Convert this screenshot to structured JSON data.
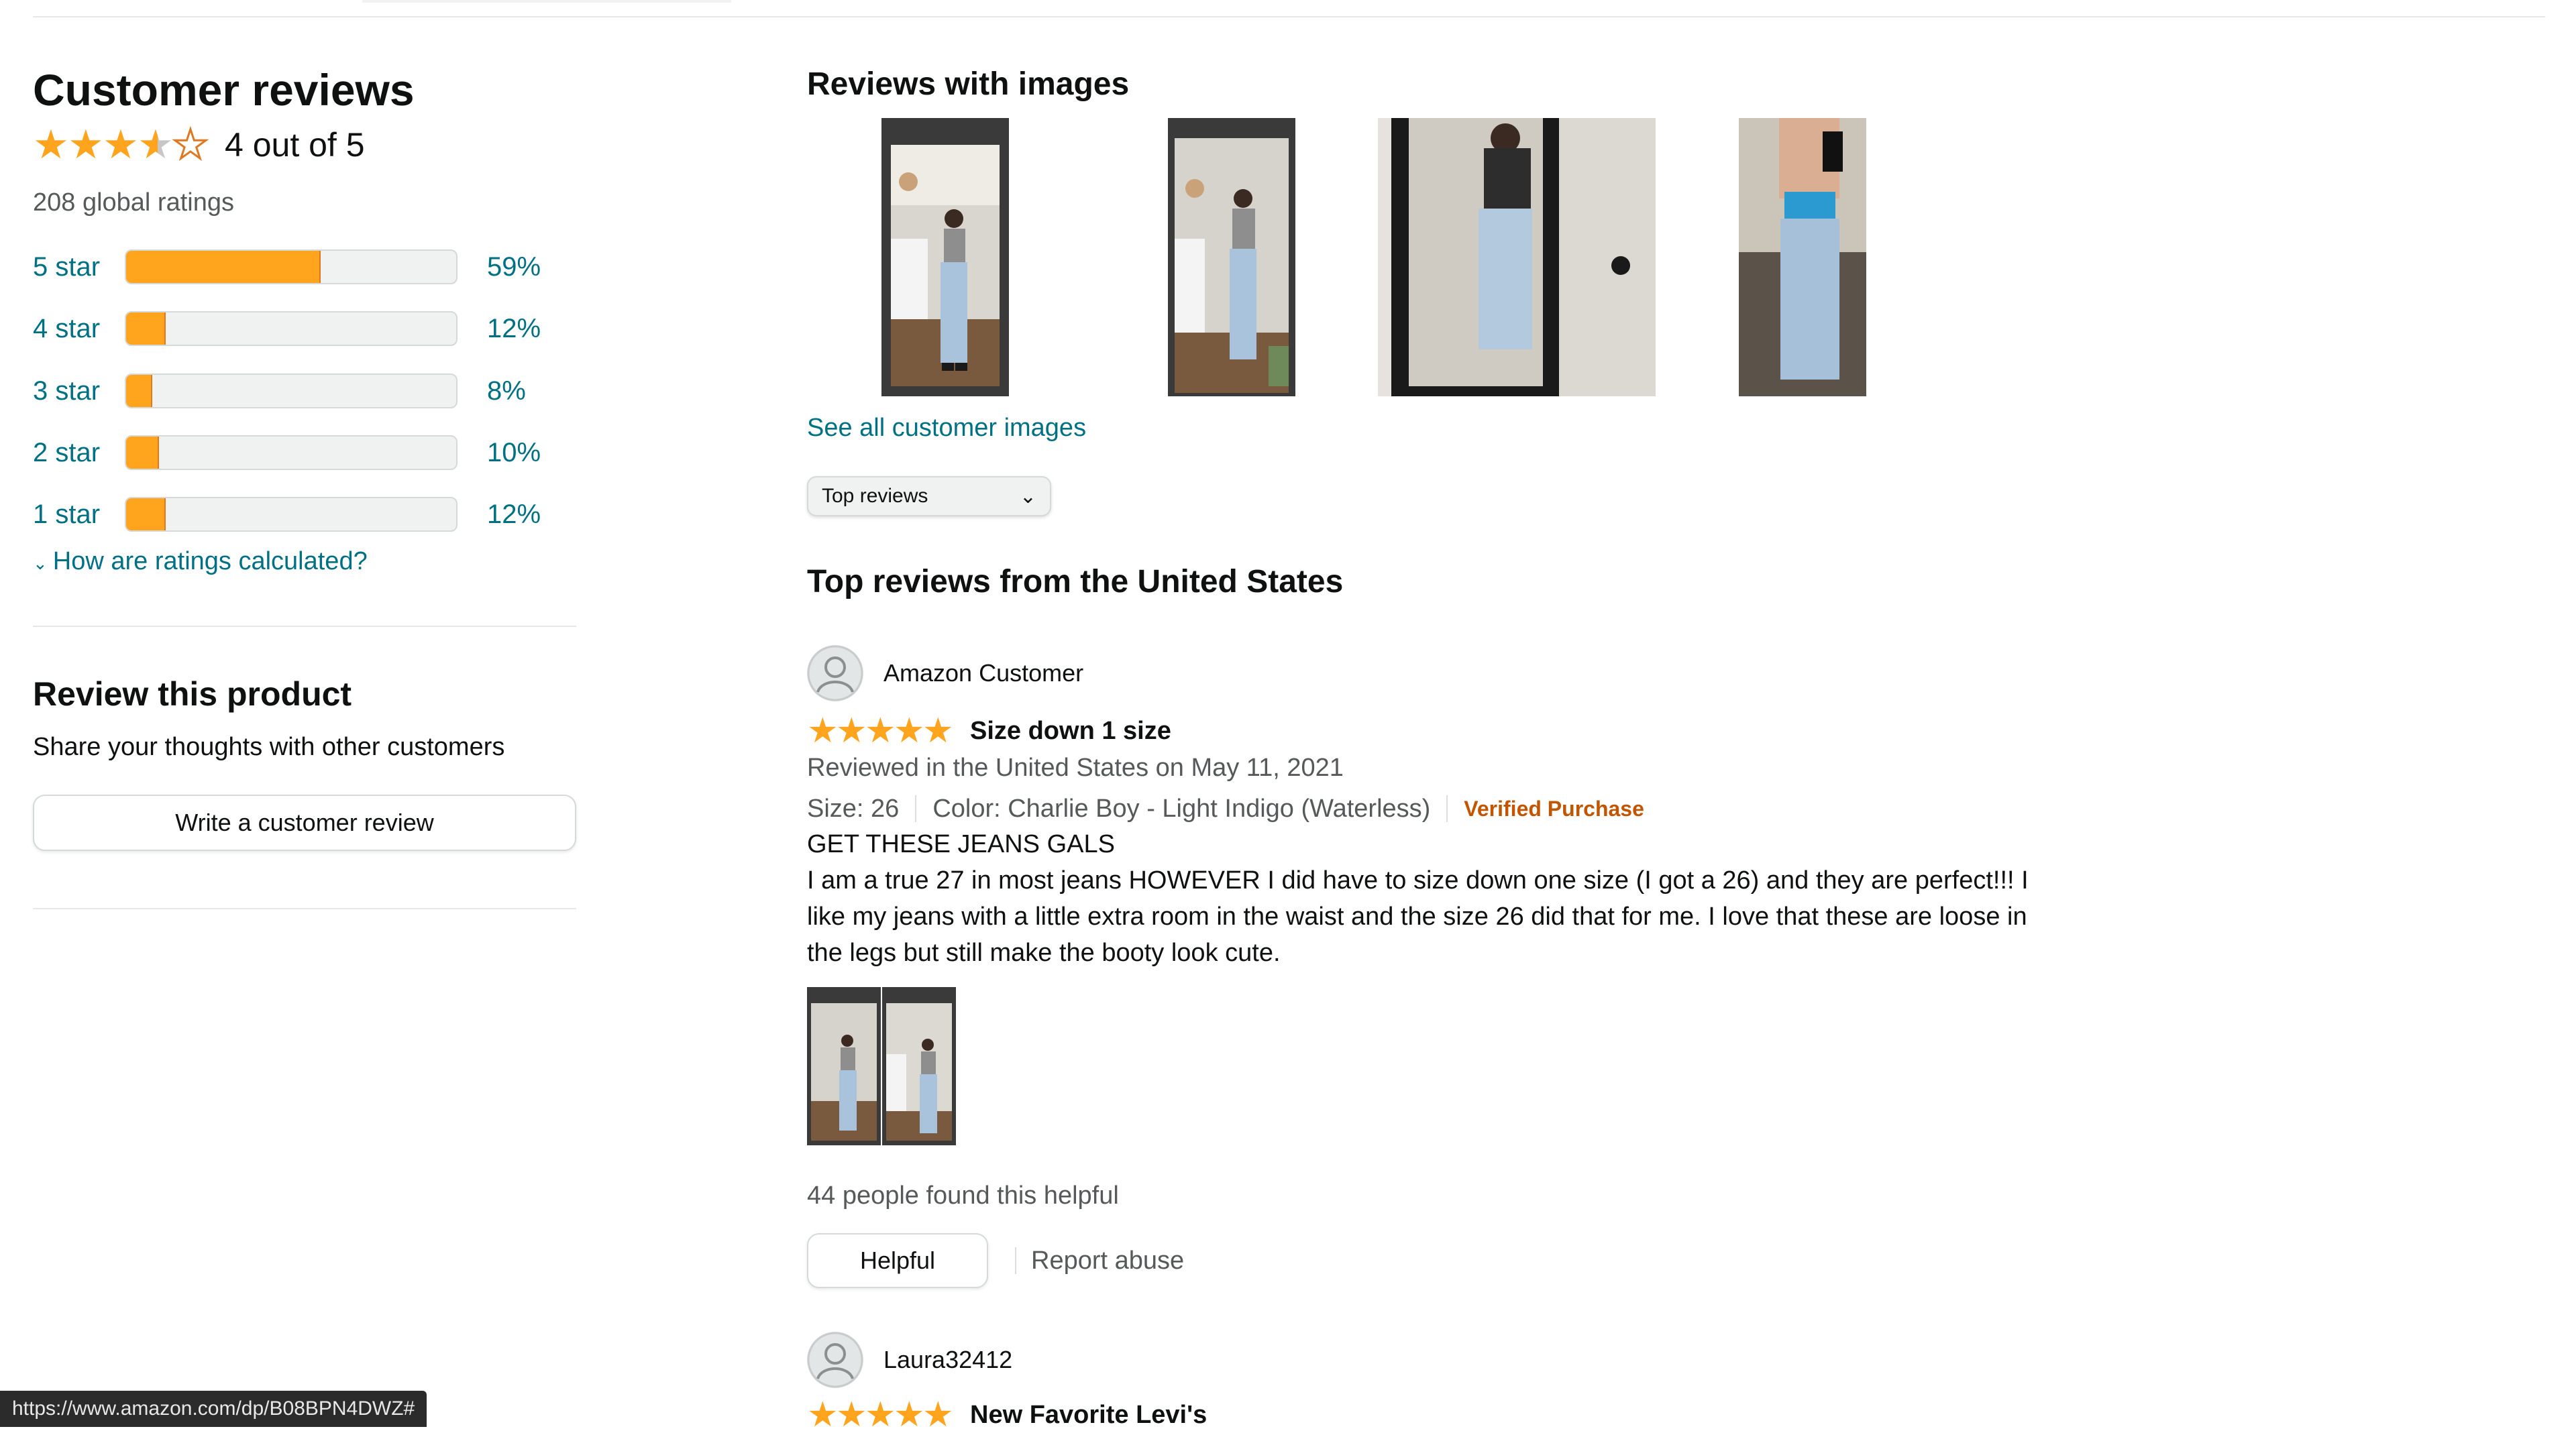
{
  "summary": {
    "heading": "Customer reviews",
    "rating_value": 4,
    "rating_text": "4 out of 5",
    "global_ratings": "208 global ratings",
    "how_calculated": "How are ratings calculated?"
  },
  "histogram": [
    {
      "label": "5 star",
      "percent": 59,
      "percent_text": "59%"
    },
    {
      "label": "4 star",
      "percent": 12,
      "percent_text": "12%"
    },
    {
      "label": "3 star",
      "percent": 8,
      "percent_text": "8%"
    },
    {
      "label": "2 star",
      "percent": 10,
      "percent_text": "10%"
    },
    {
      "label": "1 star",
      "percent": 12,
      "percent_text": "12%"
    }
  ],
  "review_product": {
    "heading": "Review this product",
    "subtext": "Share your thoughts with other customers",
    "button_label": "Write a customer review"
  },
  "images_section": {
    "heading": "Reviews with images",
    "see_all": "See all customer images",
    "thumbnails": [
      "customer-photo-1",
      "customer-photo-2",
      "customer-photo-3",
      "customer-photo-4"
    ]
  },
  "sort": {
    "selected": "Top reviews"
  },
  "top_reviews": {
    "heading": "Top reviews from the United States",
    "reviews": [
      {
        "author": "Amazon Customer",
        "stars": 5,
        "title": "Size down 1 size",
        "reviewed_on": "Reviewed in the United States on May 11, 2021",
        "size": "Size: 26",
        "color": "Color: Charlie Boy - Light Indigo (Waterless)",
        "verified": "Verified Purchase",
        "headline": "GET THESE JEANS GALS",
        "body": "I am a true 27 in most jeans HOWEVER I did have to size down one size (I got a 26) and they are perfect!!! I like my jeans with a little extra room in the waist and the size 26 did that for me. I love that these are loose in the legs but still make the booty look cute.",
        "helpful_count": "44 people found this helpful",
        "helpful_button": "Helpful",
        "report": "Report abuse"
      },
      {
        "author": "Laura32412",
        "stars": 5,
        "title": "New Favorite Levi's"
      }
    ]
  },
  "status_url": "https://www.amazon.com/dp/B08BPN4DWZ#",
  "colors": {
    "star": "#ffa41c",
    "link": "#007185",
    "verified": "#c45500"
  }
}
